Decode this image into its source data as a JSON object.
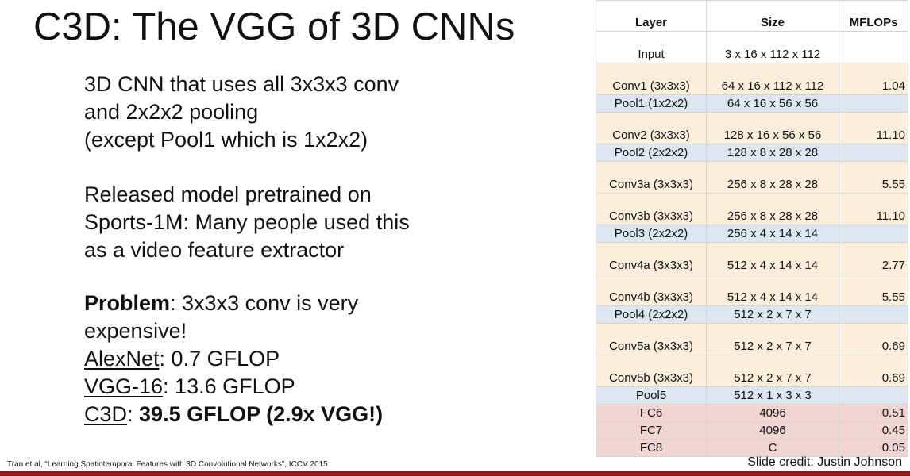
{
  "slide": {
    "title": "C3D: The VGG of 3D CNNs",
    "block1": {
      "line1": "3D CNN that uses all 3x3x3 conv",
      "line2": "and 2x2x2 pooling",
      "line3": "(except Pool1 which is 1x2x2)"
    },
    "block2": {
      "line1": "Released model pretrained on",
      "line2": "Sports-1M: Many people used this",
      "line3": "as a video feature extractor"
    },
    "block3": {
      "problem_label": "Problem",
      "problem_text": ": 3x3x3 conv is very",
      "problem_text2": "expensive!",
      "alexnet_label": "AlexNet",
      "alexnet_value": ": 0.7 GFLOP",
      "vgg_label": "VGG-16",
      "vgg_value": ": 13.6 GFLOP",
      "c3d_label": "C3D",
      "c3d_sep": ": ",
      "c3d_value": "39.5 GFLOP (2.9x VGG!)"
    },
    "citation": "Tran et al, “Learning Spatiotemporal Features with 3D Convolutional Networks”, ICCV 2015",
    "credit": "Slide credit: Justin Johnson",
    "colors": {
      "conv_row": "#fbeedb",
      "pool_row": "#dde7f2",
      "fc_row": "#f2d4d4",
      "bottom_bar": "#8b1a1a"
    }
  },
  "table": {
    "headers": {
      "layer": "Layer",
      "size": "Size",
      "mflops": "MFLOPs"
    },
    "rows": [
      {
        "layer": "Input",
        "size": "3 x 16 x 112 x 112",
        "mflops": "",
        "kind": "input",
        "height": "tall"
      },
      {
        "layer": "Conv1 (3x3x3)",
        "size": "64 x 16 x 112 x 112",
        "mflops": "1.04",
        "kind": "conv",
        "height": "tall"
      },
      {
        "layer": "Pool1 (1x2x2)",
        "size": "64 x 16 x 56 x 56",
        "mflops": "",
        "kind": "pool",
        "height": "short"
      },
      {
        "layer": "Conv2 (3x3x3)",
        "size": "128 x 16 x 56 x 56",
        "mflops": "11.10",
        "kind": "conv",
        "height": "tall"
      },
      {
        "layer": "Pool2 (2x2x2)",
        "size": "128 x 8 x 28 x 28",
        "mflops": "",
        "kind": "pool",
        "height": "short"
      },
      {
        "layer": "Conv3a (3x3x3)",
        "size": "256 x 8 x 28 x 28",
        "mflops": "5.55",
        "kind": "conv",
        "height": "tall"
      },
      {
        "layer": "Conv3b (3x3x3)",
        "size": "256 x 8 x 28 x 28",
        "mflops": "11.10",
        "kind": "conv",
        "height": "tall"
      },
      {
        "layer": "Pool3 (2x2x2)",
        "size": "256 x 4 x 14 x 14",
        "mflops": "",
        "kind": "pool",
        "height": "short"
      },
      {
        "layer": "Conv4a (3x3x3)",
        "size": "512 x 4 x 14 x 14",
        "mflops": "2.77",
        "kind": "conv",
        "height": "tall"
      },
      {
        "layer": "Conv4b (3x3x3)",
        "size": "512 x 4 x 14 x 14",
        "mflops": "5.55",
        "kind": "conv",
        "height": "tall"
      },
      {
        "layer": "Pool4 (2x2x2)",
        "size": "512 x 2 x 7 x 7",
        "mflops": "",
        "kind": "pool",
        "height": "short"
      },
      {
        "layer": "Conv5a (3x3x3)",
        "size": "512 x 2 x 7 x 7",
        "mflops": "0.69",
        "kind": "conv",
        "height": "tall"
      },
      {
        "layer": "Conv5b (3x3x3)",
        "size": "512 x 2 x 7 x 7",
        "mflops": "0.69",
        "kind": "conv",
        "height": "tall"
      },
      {
        "layer": "Pool5",
        "size": "512 x 1 x 3 x 3",
        "mflops": "",
        "kind": "pool",
        "height": "short"
      },
      {
        "layer": "FC6",
        "size": "4096",
        "mflops": "0.51",
        "kind": "fc",
        "height": "short"
      },
      {
        "layer": "FC7",
        "size": "4096",
        "mflops": "0.45",
        "kind": "fc",
        "height": "short"
      },
      {
        "layer": "FC8",
        "size": "C",
        "mflops": "0.05",
        "kind": "fc",
        "height": "short"
      }
    ]
  }
}
